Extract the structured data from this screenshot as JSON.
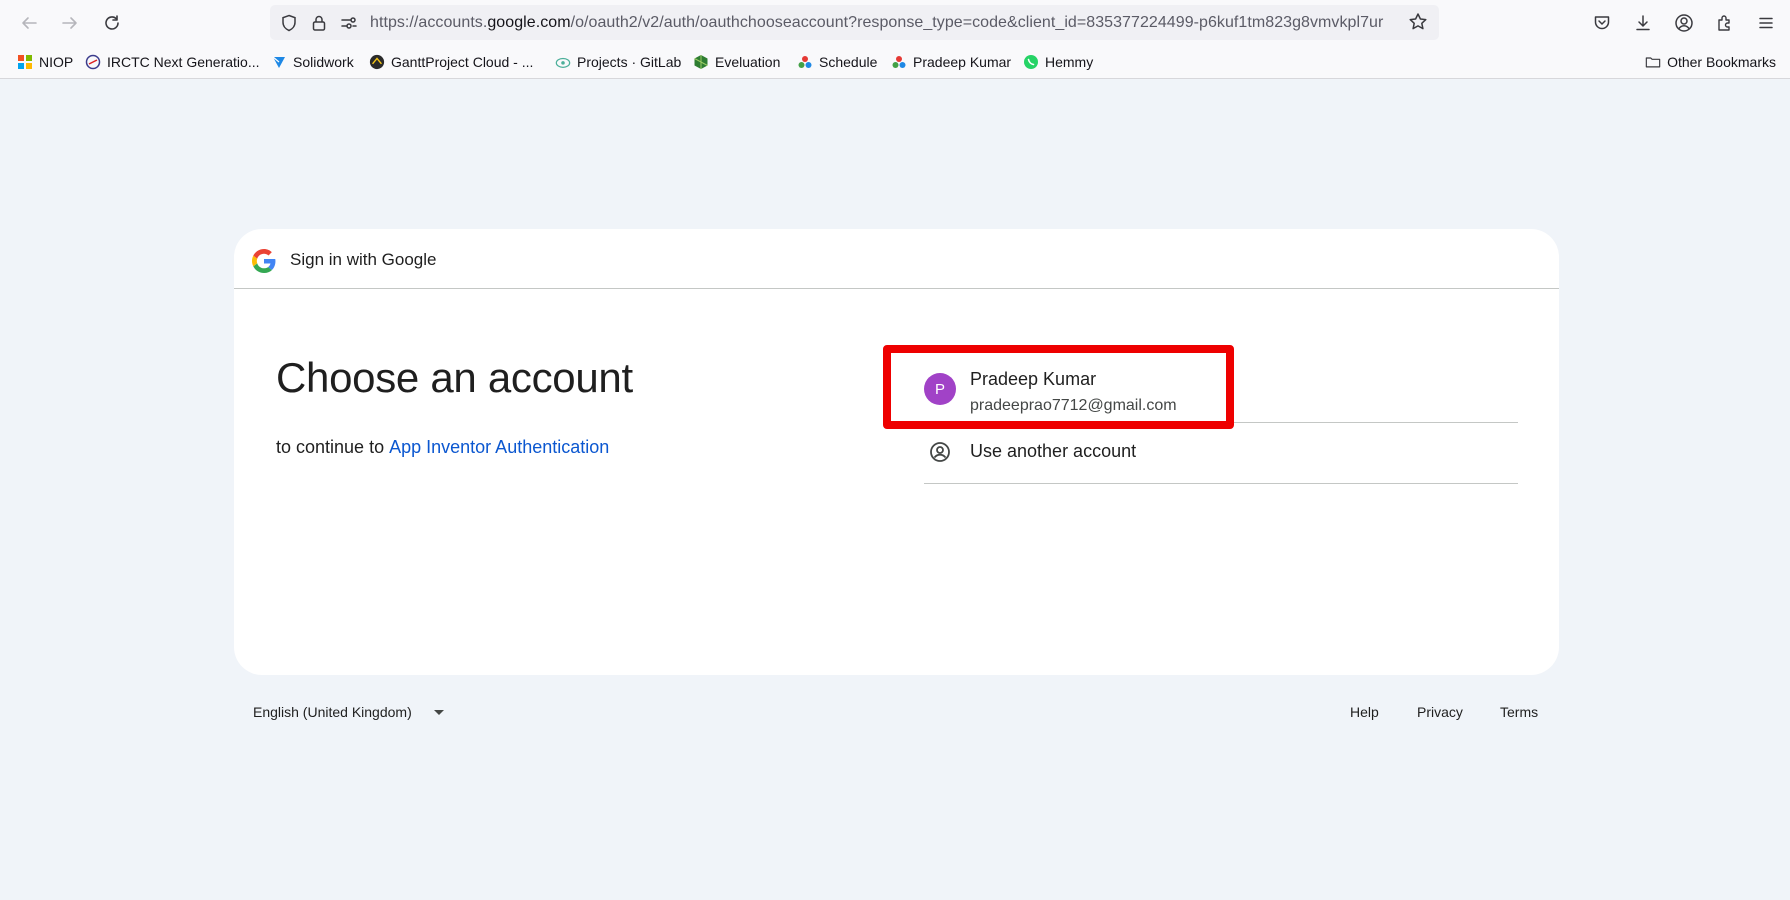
{
  "browser": {
    "url_prefix": "https://accounts.",
    "url_host": "google.com",
    "url_path": "/o/oauth2/v2/auth/oauthchooseaccount?response_type=code&client_id=835377224499-p6kuf1tm823g8vmvkpl7ur"
  },
  "bookmarks": [
    {
      "label": "NIOP"
    },
    {
      "label": "IRCTC Next Generatio..."
    },
    {
      "label": "Solidwork"
    },
    {
      "label": "GanttProject Cloud - ..."
    },
    {
      "label": "Projects · GitLab"
    },
    {
      "label": "Eveluation"
    },
    {
      "label": "Schedule"
    },
    {
      "label": "Pradeep Kumar"
    },
    {
      "label": "Hemmy"
    }
  ],
  "other_bookmarks": "Other Bookmarks",
  "card": {
    "header": "Sign in with Google",
    "title": "Choose an account",
    "subtitle_prefix": "to continue to",
    "app_name": "App Inventor Authentication"
  },
  "account": {
    "initial": "P",
    "name": "Pradeep Kumar",
    "email": "pradeeprao7712@gmail.com",
    "avatar_color": "#a142c7"
  },
  "use_another": "Use another account",
  "footer": {
    "language": "English (United Kingdom)",
    "help": "Help",
    "privacy": "Privacy",
    "terms": "Terms"
  },
  "colors": {
    "page_bg": "#f0f4f9",
    "link": "#0b57d0",
    "highlight": "#ee0000"
  }
}
